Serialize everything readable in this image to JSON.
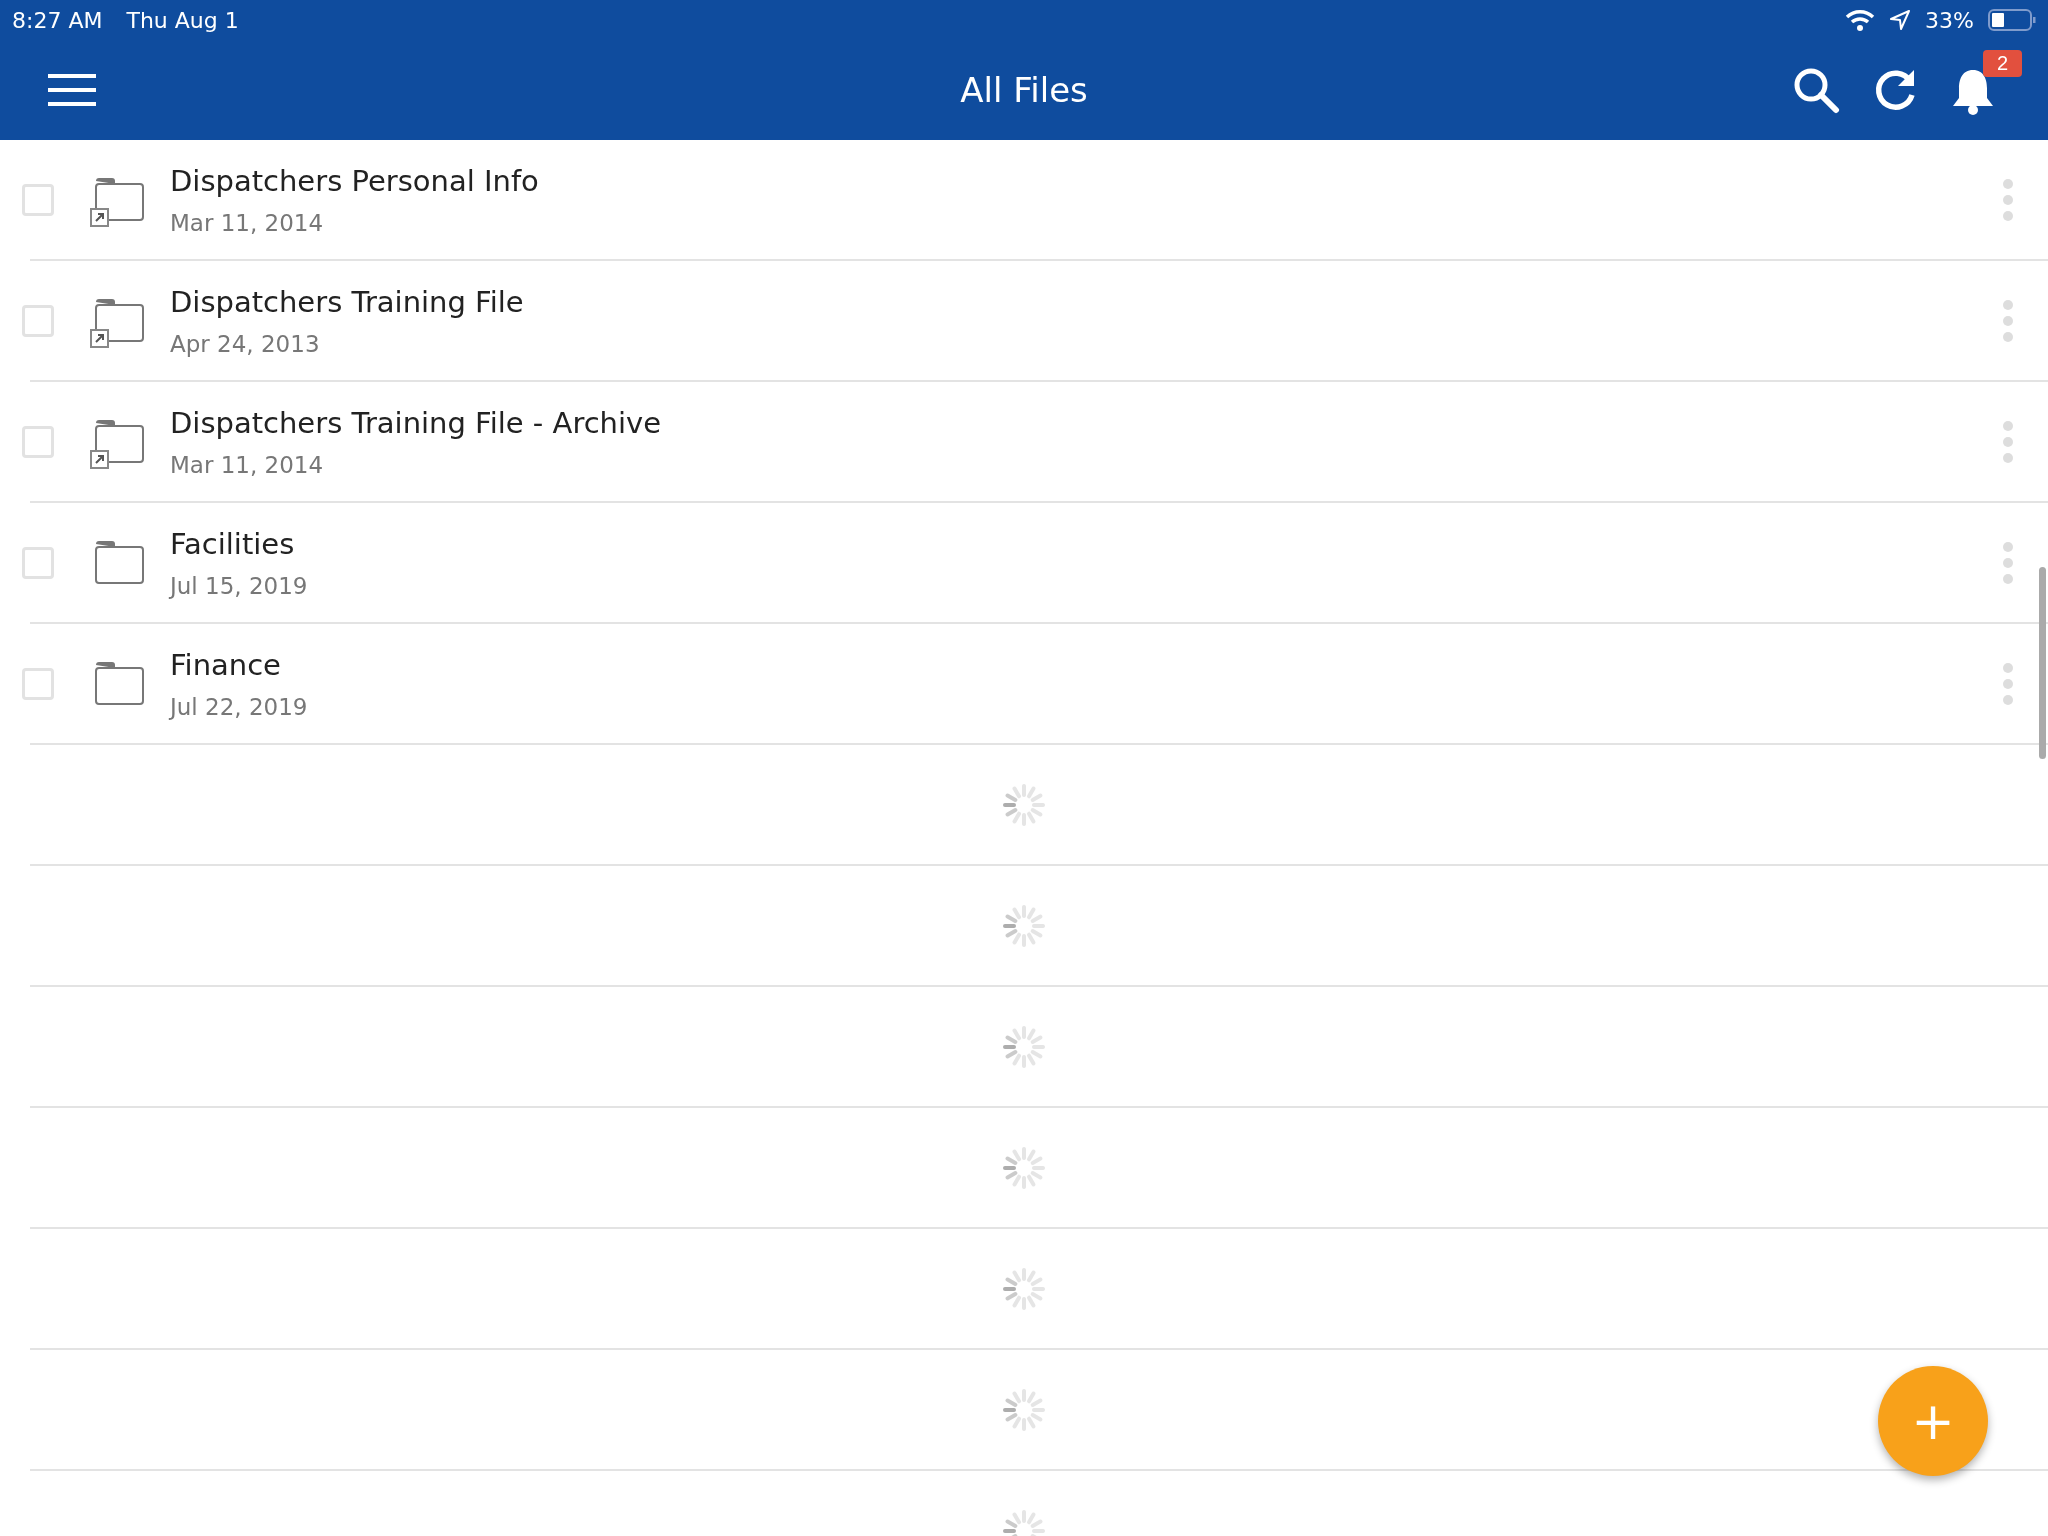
{
  "status_bar": {
    "time": "8:27 AM",
    "date": "Thu Aug 1",
    "battery": "33%"
  },
  "header": {
    "title": "All Files",
    "notification_count": "2"
  },
  "files": [
    {
      "name": "Dispatchers Personal Info",
      "date": "Mar 11, 2014",
      "shortcut": true,
      "checked": false
    },
    {
      "name": "Dispatchers Training File",
      "date": "Apr 24, 2013",
      "shortcut": true,
      "checked": false
    },
    {
      "name": "Dispatchers Training File - Archive",
      "date": "Mar 11, 2014",
      "shortcut": true,
      "checked": false
    },
    {
      "name": "Facilities",
      "date": "Jul 15, 2019",
      "shortcut": false,
      "checked": false
    },
    {
      "name": "Finance",
      "date": "Jul 22, 2019",
      "shortcut": false,
      "checked": false
    }
  ],
  "loading_rows": [
    {
      "kind": "spinner"
    },
    {
      "kind": "spinner"
    },
    {
      "kind": "spinner"
    },
    {
      "kind": "spinner"
    },
    {
      "kind": "spinner"
    },
    {
      "kind": "spinner"
    },
    {
      "kind": "spinner"
    }
  ],
  "fab": {
    "label": "+"
  }
}
